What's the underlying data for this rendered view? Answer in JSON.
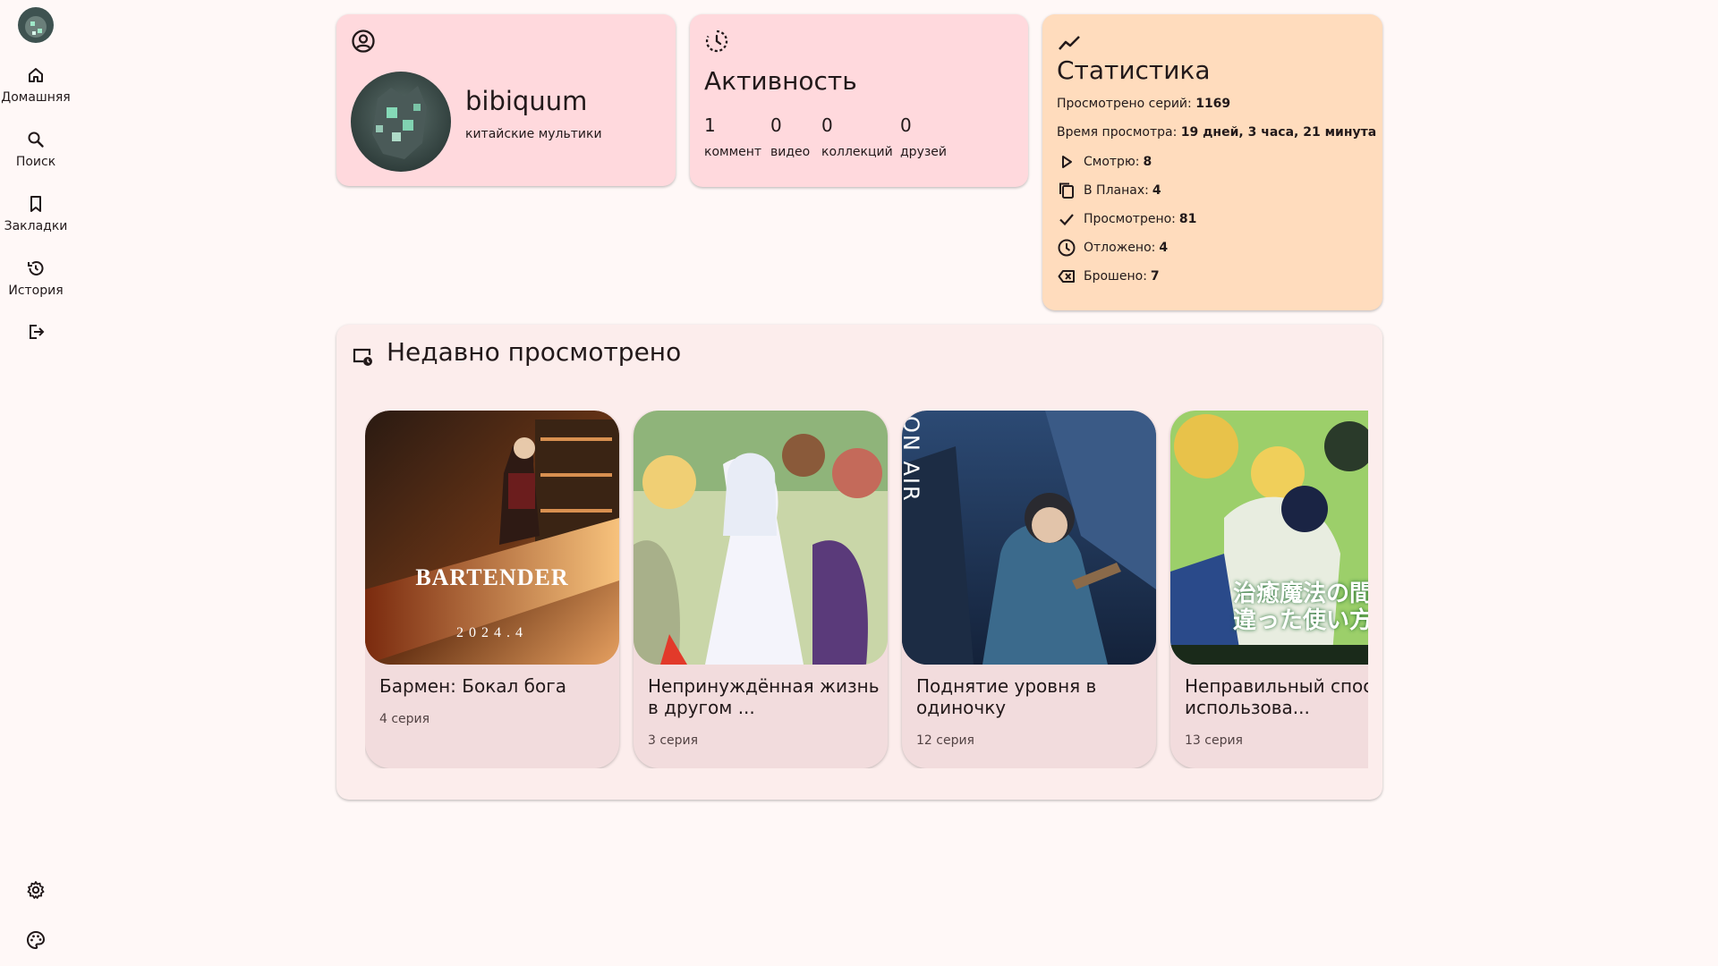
{
  "sidebar": {
    "items": [
      {
        "label": "Домашняя",
        "icon": "home-icon"
      },
      {
        "label": "Поиск",
        "icon": "search-icon"
      },
      {
        "label": "Закладки",
        "icon": "bookmark-icon"
      },
      {
        "label": "История",
        "icon": "history-icon"
      }
    ],
    "logout_icon": "logout-icon",
    "settings_icon": "gear-icon",
    "theme_icon": "palette-icon"
  },
  "profile": {
    "icon": "account-circle-icon",
    "username": "bibiquum",
    "status": "китайские мультики"
  },
  "activity": {
    "icon": "activity-icon",
    "title": "Активность",
    "stats": [
      {
        "value": "1",
        "label": "коммент"
      },
      {
        "value": "0",
        "label": "видео"
      },
      {
        "value": "0",
        "label": "коллекций"
      },
      {
        "value": "0",
        "label": "друзей"
      }
    ]
  },
  "stats": {
    "icon": "trending-icon",
    "title": "Статистика",
    "episodes_label": "Просмотрено серий:",
    "episodes_value": "1169",
    "time_label": "Время просмотра:",
    "time_value": "19 дней, 3 часа, 21 минута",
    "lists": [
      {
        "icon": "play-icon",
        "label": "Смотрю:",
        "value": "8"
      },
      {
        "icon": "copy-icon",
        "label": "В Планах:",
        "value": "4"
      },
      {
        "icon": "check-icon",
        "label": "Просмотрено:",
        "value": "81"
      },
      {
        "icon": "clock-icon",
        "label": "Отложено:",
        "value": "4"
      },
      {
        "icon": "backspace-icon",
        "label": "Брошено:",
        "value": "7"
      }
    ]
  },
  "recent": {
    "icon": "recent-history-icon",
    "title": "Недавно просмотрено",
    "items": [
      {
        "title": "Бармен: Бокал бога",
        "episode": "4 серия",
        "poster_text": "BARTENDER",
        "poster_sub": "2024.4"
      },
      {
        "title": "Непринуждённая жизнь в другом ...",
        "episode": "3 серия"
      },
      {
        "title": "Поднятие уровня в одиночку",
        "episode": "12 серия",
        "poster_text": "ON AIR"
      },
      {
        "title": "Неправильный способ использова...",
        "episode": "13 серия",
        "poster_text": "治癒魔法の間違った使い方"
      }
    ]
  }
}
